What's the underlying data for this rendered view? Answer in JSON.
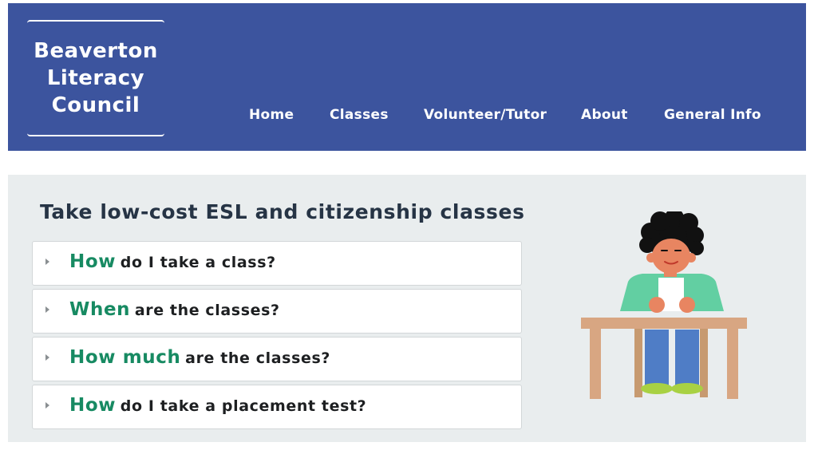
{
  "header": {
    "logo_lines": [
      "Beaverton",
      "Literacy",
      "Council"
    ],
    "nav": [
      {
        "label": "Home"
      },
      {
        "label": "Classes"
      },
      {
        "label": "Volunteer/Tutor"
      },
      {
        "label": "About"
      },
      {
        "label": "General Info"
      }
    ]
  },
  "main": {
    "title": "Take low-cost ESL and citizenship classes",
    "faqs": [
      {
        "highlight": "How",
        "rest": "do I take a class?"
      },
      {
        "highlight": "When",
        "rest": "are the classes?"
      },
      {
        "highlight": "How much",
        "rest": "are the classes?"
      },
      {
        "highlight": "How",
        "rest": "do I take a placement test?"
      }
    ]
  },
  "colors": {
    "header_bg": "#3c549e",
    "content_bg": "#e9edee",
    "highlight": "#178a62",
    "title_text": "#263445"
  },
  "icons": {
    "faq_toggle": "caret-right-icon",
    "illustration": "student-at-desk"
  }
}
